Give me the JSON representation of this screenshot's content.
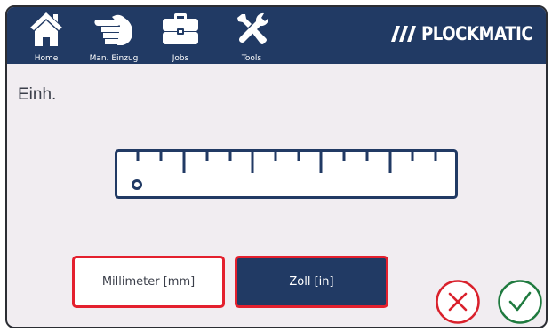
{
  "header": {
    "nav": [
      {
        "label": "Home",
        "icon": "home-icon"
      },
      {
        "label": "Man. Einzug",
        "icon": "hand-icon"
      },
      {
        "label": "Jobs",
        "icon": "briefcase-icon"
      },
      {
        "label": "Tools",
        "icon": "tools-icon"
      }
    ],
    "logo_text": "PLOCKMATIC",
    "background": "#213a64"
  },
  "page": {
    "title": "Einh.",
    "illustration": "ruler-icon"
  },
  "units": {
    "millimeter_label": "Millimeter [mm]",
    "inch_label": "Zoll [in]",
    "selected": "Zoll [in]"
  },
  "actions": {
    "cancel_icon": "close-circle-icon",
    "confirm_icon": "check-circle-icon"
  },
  "colors": {
    "brand_navy": "#213a64",
    "accent_red": "#e4202e",
    "confirm_green": "#1f7a3f",
    "background": "#f1edf1"
  }
}
